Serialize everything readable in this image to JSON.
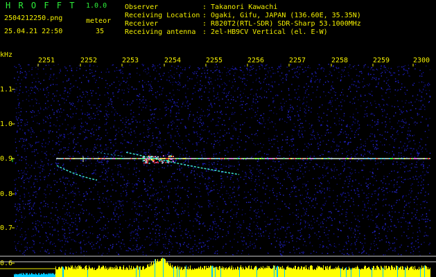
{
  "header": {
    "app_name": "H R O F F T",
    "version": "1.0.0",
    "filename": "2504212250.png",
    "datetime": "25.04.21 22:50",
    "meteor_label": "meteor",
    "meteor_count": "35",
    "info_labels": [
      "Observer",
      "Receiving Location",
      "Receiver",
      "Receiving antenna"
    ],
    "info_values": [
      ": Takanori Kawachi",
      ": Ogaki, Gifu, JAPAN (136.60E, 35.35N)",
      ": R820T2(RTL-SDR) SDR-Sharp 53.1000MHz",
      ": 2el-HB9CV Vertical (el. E-W)"
    ]
  },
  "spectrogram": {
    "y_unit": "kHz",
    "x_ticks": [
      "2251",
      "2252",
      "2253",
      "2254",
      "2255",
      "2256",
      "2257",
      "2258",
      "2259",
      "2300"
    ],
    "y_ticks": [
      "1.1",
      "1.0",
      "0.9",
      "0.8",
      "0.7",
      "0.6"
    ],
    "colors": {
      "label": "#f4f000",
      "background": "#000000",
      "noise": "#1a1aa8",
      "carrier": "#d8f0d8",
      "activity": "#ffff00",
      "activity_low": "#00c8ff"
    }
  }
}
